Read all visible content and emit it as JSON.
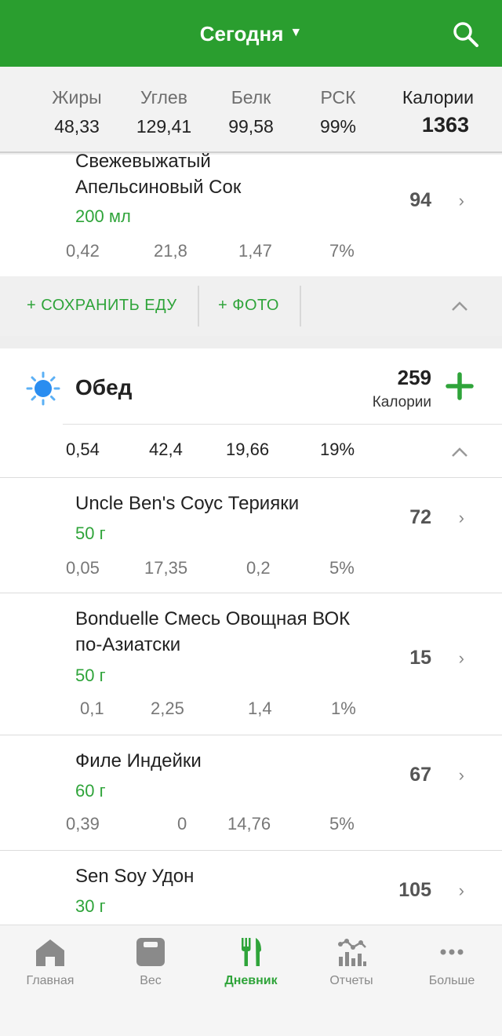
{
  "header": {
    "title": "Сегодня"
  },
  "summary": [
    {
      "label": "Жиры",
      "value": "48,33"
    },
    {
      "label": "Углев",
      "value": "129,41"
    },
    {
      "label": "Белк",
      "value": "99,58"
    },
    {
      "label": "РСК",
      "value": "99%"
    },
    {
      "label": "Калории",
      "value": "1363"
    }
  ],
  "top_item": {
    "name_line1": "Свежевыжатый",
    "name_line2": "Апельсиновый Сок",
    "qty": "200 мл",
    "kcal": "94",
    "nutrients": [
      "0,42",
      "21,8",
      "1,47",
      "7%"
    ]
  },
  "actions": {
    "save_food": "+ СОХРАНИТЬ ЕДУ",
    "photo": "+ ФОТО"
  },
  "lunch": {
    "title": "Обед",
    "kcal": "259",
    "kcal_label": "Калории",
    "nutrients": [
      "0,54",
      "42,4",
      "19,66",
      "19%"
    ]
  },
  "items": [
    {
      "name_line1": "Uncle Ben's  Соус Терияки",
      "name_line2": "",
      "qty": "50 г",
      "kcal": "72",
      "nutrients": [
        "0,05",
        "17,35",
        "0,2",
        "5%"
      ]
    },
    {
      "name_line1": "Bonduelle Смесь Овощная ВОК",
      "name_line2": "по-Азиатски",
      "qty": "50 г",
      "kcal": "15",
      "nutrients": [
        "0,1",
        "2,25",
        "1,4",
        "1%"
      ]
    },
    {
      "name_line1": "Филе Индейки",
      "name_line2": "",
      "qty": "60 г",
      "kcal": "67",
      "nutrients": [
        "0,39",
        "0",
        "14,76",
        "5%"
      ]
    },
    {
      "name_line1": "Sen Soy Удон",
      "name_line2": "",
      "qty": "30 г",
      "kcal": "105",
      "nutrients": []
    }
  ],
  "nav": [
    {
      "label": "Главная",
      "icon": "home-icon"
    },
    {
      "label": "Вес",
      "icon": "scale-icon"
    },
    {
      "label": "Дневник",
      "icon": "fork-knife-icon"
    },
    {
      "label": "Отчеты",
      "icon": "chart-icon"
    },
    {
      "label": "Больше",
      "icon": "more-icon"
    }
  ],
  "colors": {
    "brand": "#2a9e2f",
    "accent_text": "#2fa43a"
  }
}
